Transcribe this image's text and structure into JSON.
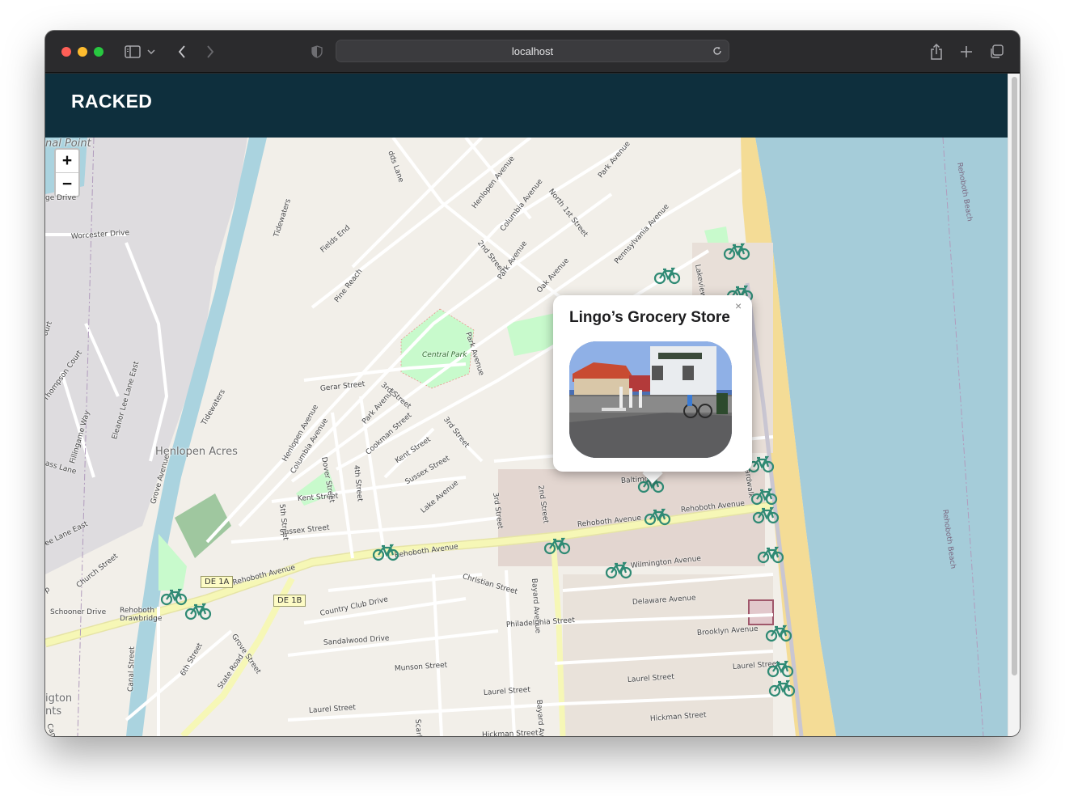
{
  "browser": {
    "url": "localhost",
    "icons": [
      "sidebar-icon",
      "chevron-down-icon",
      "back-icon",
      "forward-icon",
      "shield-icon",
      "reload-icon",
      "share-icon",
      "new-tab-icon",
      "tab-overview-icon"
    ]
  },
  "app": {
    "title": "RACKED"
  },
  "map": {
    "zoom_in": "+",
    "zoom_out": "−",
    "popup": {
      "title": "Lingo’s Grocery Store",
      "close": "×"
    },
    "place_labels": {
      "henlopen_acres": "Henlopen Acres",
      "central_park": "Central Park",
      "rehoboth_drawbridge": "Rehoboth Drawbridge",
      "point": "nal Point",
      "rehoboth_beach": "Rehoboth Beach",
      "rehoboth_beach_2": "Rehoboth Beach",
      "lington": "igton",
      "nts": "nts",
      "canal": "Canal"
    },
    "street_labels": {
      "worcester_drive": "Worcester Drive",
      "ge_drive": "ge Drive",
      "tidewaters_1": "Tidewaters",
      "tidewaters_2": "Tidewaters",
      "fields_end": "Fields End",
      "pine_reach": "Pine Reach",
      "henlopen_avenue_1": "Henlopen Avenue",
      "henlopen_avenue_2": "Henlopen Avenue",
      "columbia_avenue_1": "Columbia Avenue",
      "columbia_avenue_2": "Columbia Avenue",
      "north_1st_street": "North 1st Street",
      "park_avenue_1": "Park Avenue",
      "park_avenue_2": "Park Avenue",
      "park_avenue_3": "Park Avenue",
      "park_avenue_4": "Park Avenue",
      "pennsylvania_avenue": "Pennsylvania Avenue",
      "oak_avenue": "Oak Avenue",
      "second_street_1": "2nd Street",
      "second_street_2": "2nd Street",
      "third_street_1": "3rd Street",
      "third_street_2": "3rd Street",
      "third_street_3": "3rd Street",
      "fourth_street": "4th Street",
      "fifth_street": "5th Street",
      "sixth_street": "6th Street",
      "gerar_street": "Gerar Street",
      "cookman_street": "Cookman Street",
      "kent_street_1": "Kent Street",
      "kent_street_2": "Kent Street",
      "dover_street": "Dover Street",
      "sussex_street_1": "Sussex Street",
      "sussex_street_2": "Sussex Street",
      "lake_avenue": "Lake Avenue",
      "baltimore_avenue": "Baltimore",
      "rehoboth_avenue_1": "Rehoboth Avenue",
      "rehoboth_avenue_2": "Rehoboth Avenue",
      "rehoboth_avenue_3": "Rehoboth Avenue",
      "rehoboth_avenue_4": "Rehoboth Avenue",
      "wilmington_avenue": "Wilmington Avenue",
      "christian_street": "Christian Street",
      "delaware_avenue": "Delaware Avenue",
      "philadelphia_street": "Philadelphia Street",
      "brooklyn_avenue": "Brooklyn Avenue",
      "laurel_street_1": "Laurel Street",
      "laurel_street_2": "Laurel Street",
      "laurel_street_3": "Laurel Street",
      "laurel_street_4": "Laurel Street",
      "hickman_street_1": "Hickman Street",
      "hickman_street_2": "Hickman Street",
      "bayard_avenue_1": "Bayard Avenue",
      "bayard_avenue_2": "Bayard Avenue",
      "scarborough": "Scarborough",
      "munson_street": "Munson Street",
      "sandalwood_drive": "Sandalwood Drive",
      "country_club_drive": "Country Club Drive",
      "canal_street": "Canal Street",
      "state_road": "State Road",
      "grove_street": "Grove Street",
      "grove_avenue": "Grove Avenue",
      "church_street": "Church Street",
      "schooner_drive": "Schooner Drive",
      "thompson_court": "Thompson Court",
      "eleanor_lee_lane_east": "Eleanor Lee Lane East",
      "fillingame_way": "Fillingame Way",
      "lane_east": "ee Lane East",
      "ass_lane": "ass Lane",
      "north_boardwalk": "North Boardwalk",
      "lakeview": "Lakeview",
      "dds_lane": "dds Lane",
      "ourt": "ourt",
      "p": "p"
    },
    "shields": {
      "de1a": "DE 1A",
      "de1b": "DE 1B"
    }
  }
}
